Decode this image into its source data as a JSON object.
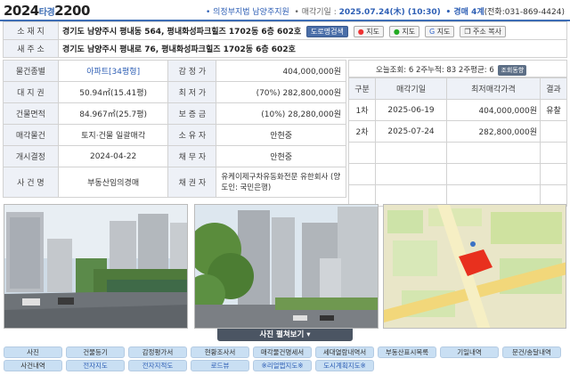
{
  "header": {
    "case_year": "2024",
    "case_type": "타경",
    "case_num": "2200",
    "court": "• 의정부지법 남양주지원",
    "sale_date_label": "• 매각기일 : ",
    "sale_date": "2025.07.24(木) (10:30)",
    "dept": "• 경매 4계",
    "phone": "(전화:031-869-4424)"
  },
  "property": {
    "location_label": "소 재 지",
    "location": "경기도 남양주시 평내동 564, 평내화성파크힐즈 1702동 6층 602호",
    "buttons": [
      "도로명검색",
      "지도",
      "지도",
      "지도",
      "주소 복사"
    ],
    "new_addr_label": "새 주 소",
    "new_addr": "경기도 남양주시 평내로 76, 평내화성파크힐즈 1702동 6층 602호"
  },
  "details": [
    {
      "label": "물건종별",
      "value": "아파트[34평형]",
      "label2": "감 정 가",
      "value2": "404,000,000원"
    },
    {
      "label": "대 지 권",
      "value": "50.94㎡(15.41평)",
      "label2": "최 저 가",
      "value2": "(70%) 282,800,000원"
    },
    {
      "label": "건물면적",
      "value": "84.967㎡(25.7평)",
      "label2": "보 증 금",
      "value2": "(10%) 28,280,000원"
    },
    {
      "label": "매각물건",
      "value": "토지·건물 일괄매각",
      "label2": "소 유 자",
      "value2": "안현중"
    },
    {
      "label": "개시결정",
      "value": "2024-04-22",
      "label2": "채 무 자",
      "value2": "안현중"
    },
    {
      "label": "사 건 명",
      "value": "부동산임의경매",
      "label2": "채 권 자",
      "value2": "유케이제구차유동화전문 유한회사 (양도인: 국민은행)"
    }
  ],
  "views": {
    "text": "오늘조회: 6  2주누적: 83  2주평균: 6",
    "button": "조회동향"
  },
  "history": {
    "headers": [
      "구분",
      "매각기일",
      "최저매각가격",
      "결과"
    ],
    "rows": [
      {
        "round": "1차",
        "date": "2025-06-19",
        "price": "404,000,000원",
        "result": "유찰"
      },
      {
        "round": "2차",
        "date": "2025-07-24",
        "price": "282,800,000원",
        "result": ""
      }
    ]
  },
  "photos_label": "사진 펼쳐보기 ▾",
  "nav": {
    "row1": [
      "사진",
      "건물등기",
      "감정평가서",
      "현황조사서",
      "매각물건명세서",
      "세대열람내역서",
      "부동산표시목록",
      "기일내역",
      "문건/송달내역"
    ],
    "row2": [
      "사건내역",
      "전자지도",
      "전자지적도",
      "로드뷰",
      "※리얼맵지도※",
      "도시계획지도※"
    ]
  }
}
